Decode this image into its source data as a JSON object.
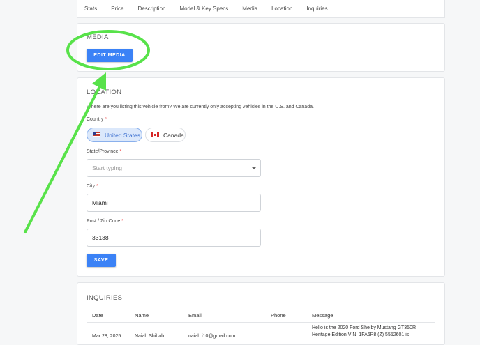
{
  "tabs": [
    "Stats",
    "Price",
    "Description",
    "Model & Key Specs",
    "Media",
    "Location",
    "Inquiries"
  ],
  "media": {
    "title": "MEDIA",
    "button": "EDIT MEDIA"
  },
  "location": {
    "title": "LOCATION",
    "description": "Where are you listing this vehicle from? We are currently only accepting vehicles in the U.S. and Canada.",
    "country_label": "Country",
    "required_mark": "*",
    "countries": [
      {
        "label": "United States",
        "selected": true
      },
      {
        "label": "Canada",
        "selected": false
      }
    ],
    "state_label": "State/Province",
    "state_placeholder": "Start typing",
    "city_label": "City",
    "city_value": "Miami",
    "zip_label": "Post / Zip Code",
    "zip_value": "33138",
    "save": "SAVE"
  },
  "inquiries": {
    "title": "INQUIRIES",
    "columns": [
      "Date",
      "Name",
      "Email",
      "Phone",
      "Message"
    ],
    "rows": [
      {
        "date": "Mar 28, 2025",
        "name": "Naiah Shibab",
        "email": "naiah.i10@gmail.com",
        "phone": "",
        "message_line1": "Hello is the 2020 Ford Shelby Mustang GT350R",
        "message_line2": "Heritage Edition VIN: 1FA6P8 (Z) 5552601 is"
      }
    ]
  },
  "colors": {
    "accent": "#3b82f6",
    "annotation": "#58e24a",
    "required": "#e33333"
  }
}
